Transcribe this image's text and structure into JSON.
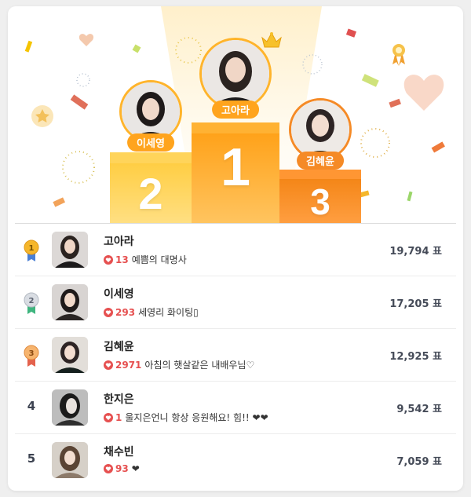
{
  "podium": [
    {
      "rank_label": "1",
      "name": "고아라"
    },
    {
      "rank_label": "2",
      "name": "이세영"
    },
    {
      "rank_label": "3",
      "name": "김혜윤"
    }
  ],
  "ranking": [
    {
      "rank": "1",
      "name": "고아라",
      "likes": "13",
      "message": "예쁨의 대명사",
      "votes": "19,794 표",
      "medal_color": "#f5b62b",
      "ribbon_color": "#4a7fd4"
    },
    {
      "rank": "2",
      "name": "이세영",
      "likes": "293",
      "message": "세영리 화이팅▯",
      "votes": "17,205 표",
      "medal_color": "#c9ced6",
      "ribbon_color": "#3fb57f"
    },
    {
      "rank": "3",
      "name": "김혜윤",
      "likes": "2971",
      "message": "아침의 햇살같은 내배우님♡",
      "votes": "12,925 표",
      "medal_color": "#f19a55",
      "ribbon_color": "#e4624d"
    },
    {
      "rank": "4",
      "name": "한지은",
      "likes": "1",
      "message": "울지은언니 항상 응원해요! 힘!! ❤❤",
      "votes": "9,542 표"
    },
    {
      "rank": "5",
      "name": "채수빈",
      "likes": "93",
      "message": "❤",
      "votes": "7,059 표"
    }
  ],
  "colors": {
    "accent": "#ffa41e",
    "heart": "#e65050"
  },
  "icons": [
    "crown-icon",
    "heart-icon",
    "medal-icon"
  ]
}
